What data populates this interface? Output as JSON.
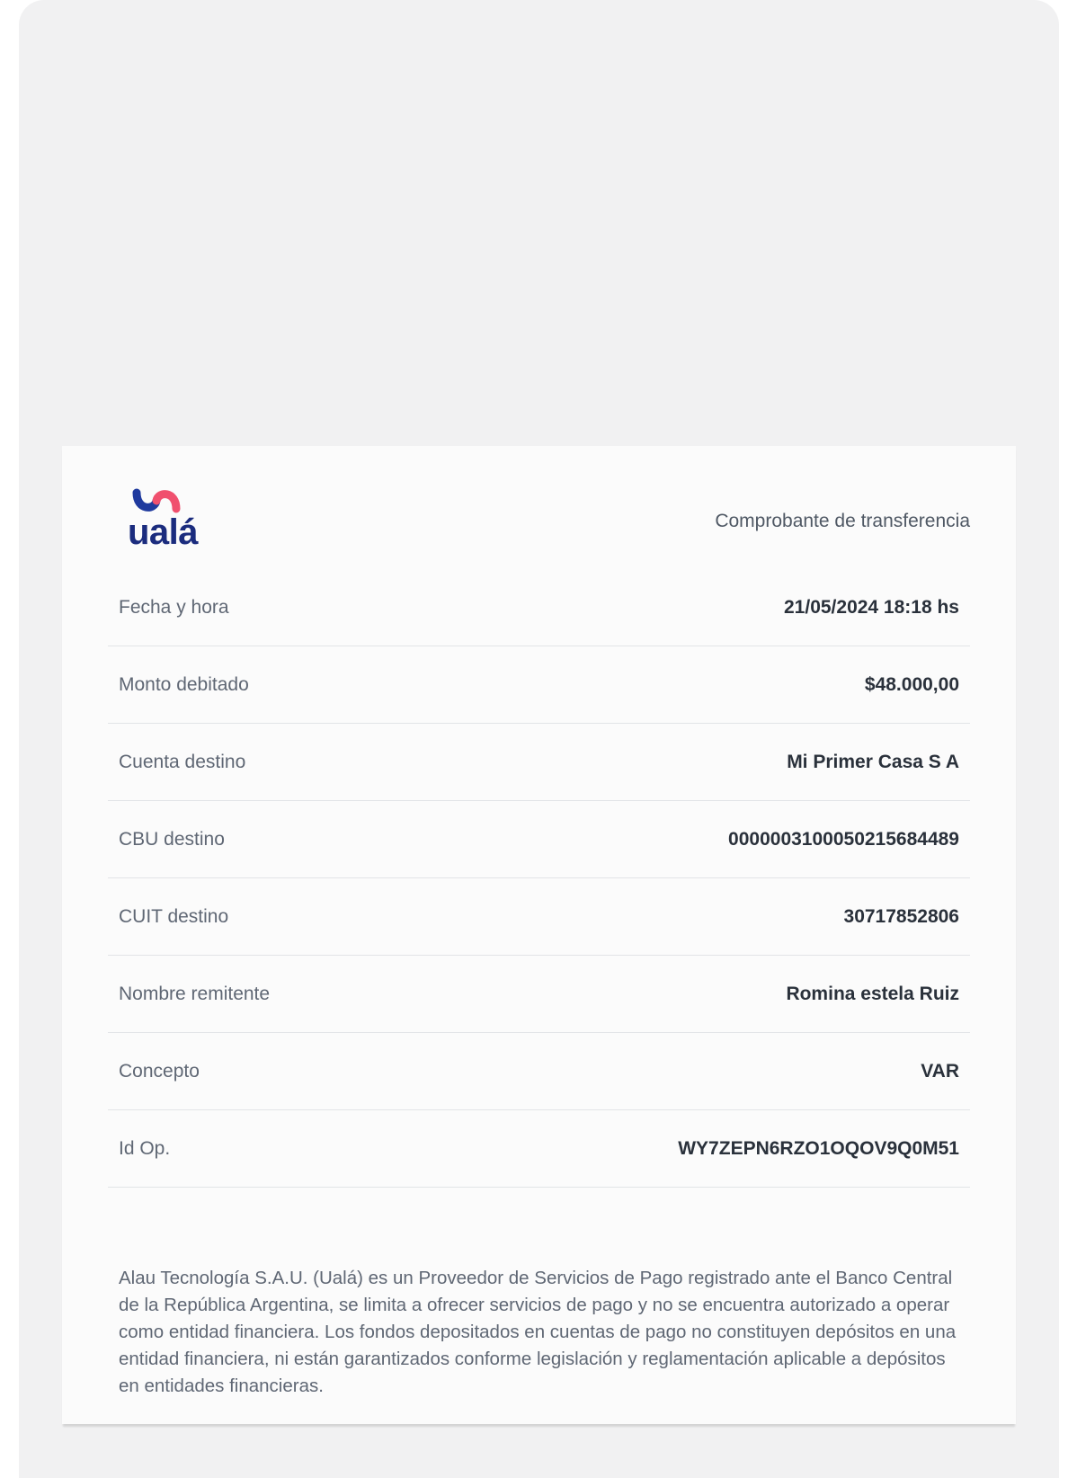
{
  "brand": {
    "name": "ualá",
    "colors": {
      "wordmark": "#1b2c7e",
      "wave_left": "#1f3a9e",
      "wave_right": "#f0506e"
    }
  },
  "receipt": {
    "title": "Comprobante de transferencia",
    "rows": [
      {
        "label": "Fecha y hora",
        "value": "21/05/2024 18:18 hs"
      },
      {
        "label": "Monto debitado",
        "value": "$48.000,00"
      },
      {
        "label": "Cuenta destino",
        "value": "Mi Primer Casa S A"
      },
      {
        "label": "CBU destino",
        "value": "0000003100050215684489"
      },
      {
        "label": "CUIT destino",
        "value": "30717852806"
      },
      {
        "label": "Nombre remitente",
        "value": "Romina estela Ruiz"
      },
      {
        "label": "Concepto",
        "value": "VAR"
      },
      {
        "label": "Id Op.",
        "value": "WY7ZEPN6RZO1OQOV9Q0M51"
      }
    ],
    "disclaimer": "Alau Tecnología S.A.U. (Ualá) es un Proveedor de Servicios de Pago registrado ante el Banco Central de la República Argentina, se limita a ofrecer servicios de pago y no se encuentra autorizado a operar como entidad financiera. Los fondos depositados en cuentas de pago no constituyen depósitos en una entidad financiera, ni están garantizados conforme legislación y reglamentación aplicable a depósitos en entidades financieras."
  }
}
